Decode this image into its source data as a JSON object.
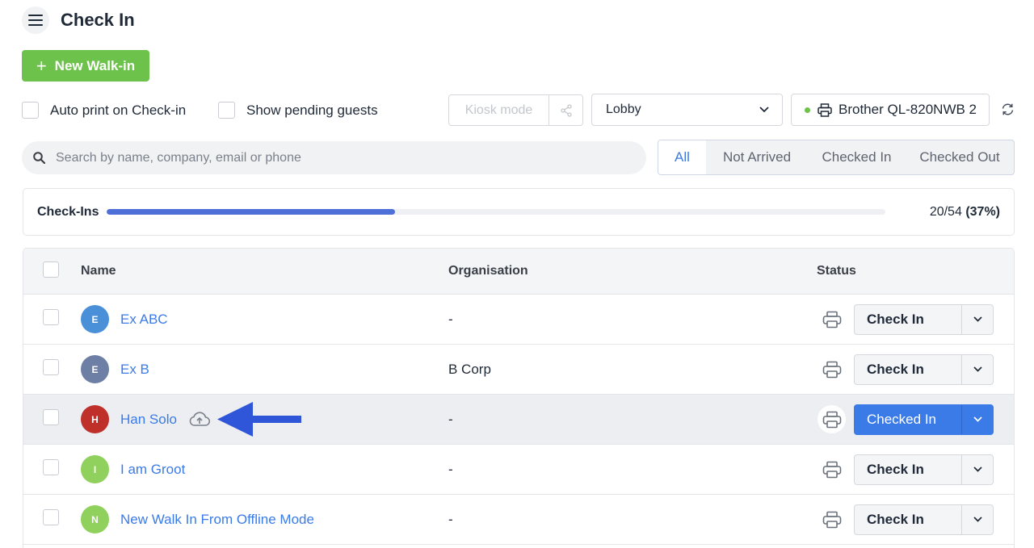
{
  "header": {
    "title": "Check In"
  },
  "actions": {
    "new_walkin": "New Walk-in"
  },
  "options": {
    "auto_print": "Auto print on Check-in",
    "show_pending": "Show pending guests"
  },
  "kiosk": {
    "label": "Kiosk mode"
  },
  "location": {
    "selected": "Lobby"
  },
  "printer": {
    "selected": "Brother QL-820NWB 2"
  },
  "search": {
    "placeholder": "Search by name, company, email or phone"
  },
  "filters": [
    {
      "label": "All",
      "active": true
    },
    {
      "label": "Not Arrived",
      "active": false
    },
    {
      "label": "Checked In",
      "active": false
    },
    {
      "label": "Checked Out",
      "active": false
    }
  ],
  "progress": {
    "label": "Check-Ins",
    "count": "20/54",
    "percent": "(37%)",
    "fraction": 0.37
  },
  "table": {
    "columns": {
      "name": "Name",
      "organisation": "Organisation",
      "status": "Status"
    },
    "rows": [
      {
        "initial": "E",
        "avatar_color": "#4a90d9",
        "name": "Ex ABC",
        "organisation": "-",
        "status": "Check In",
        "checked": false,
        "highlighted": false,
        "cloud": false
      },
      {
        "initial": "E",
        "avatar_color": "#6e7fa6",
        "name": "Ex B",
        "organisation": "B Corp",
        "status": "Check In",
        "checked": false,
        "highlighted": false,
        "cloud": false
      },
      {
        "initial": "H",
        "avatar_color": "#c0302b",
        "name": "Han Solo",
        "organisation": "-",
        "status": "Checked In",
        "checked": true,
        "highlighted": true,
        "cloud": true
      },
      {
        "initial": "I",
        "avatar_color": "#8fd15c",
        "name": "I am Groot",
        "organisation": "-",
        "status": "Check In",
        "checked": false,
        "highlighted": false,
        "cloud": false
      },
      {
        "initial": "N",
        "avatar_color": "#8fd15c",
        "name": "New Walk In From Offline Mode",
        "organisation": "-",
        "status": "Check In",
        "checked": false,
        "highlighted": false,
        "cloud": false
      }
    ]
  },
  "colors": {
    "accent": "#3b7be8",
    "primary_green": "#6cc24a",
    "annotation_arrow": "#2f55d8"
  }
}
